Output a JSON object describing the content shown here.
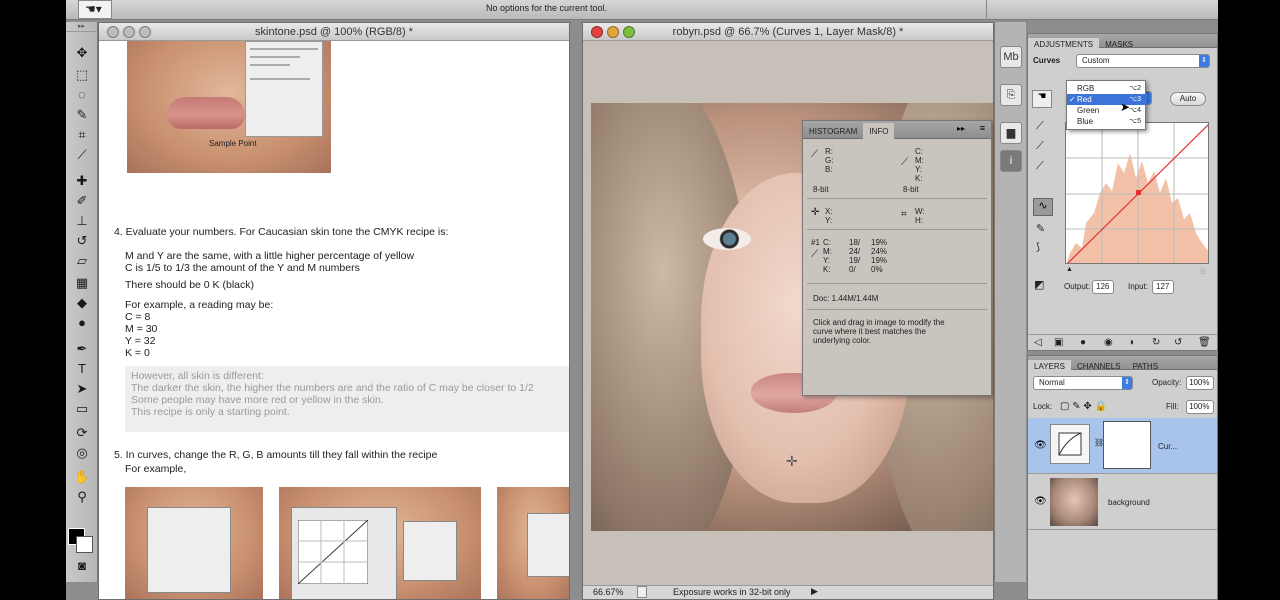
{
  "options_bar": {
    "message": "No options for the current tool."
  },
  "doc_left": {
    "title": "skintone.psd @ 100% (RGB/8) *",
    "sample_point_label": "Sample Point",
    "step4": {
      "heading": "4. Evaluate your numbers.  For Caucasian skin tone the CMYK recipe  is:",
      "lines": [
        "M and Y are the same, with a little higher percentage of yellow",
        "C is 1/5 to 1/3 the amount of the Y and M numbers",
        "There should be 0 K (black)"
      ],
      "example_intro": "For example, a reading may be:",
      "example": [
        "C = 8",
        "M = 30",
        "Y = 32",
        "K = 0"
      ]
    },
    "note": [
      "However, all skin is different:",
      "The darker the skin, the higher the numbers are and the ratio of C may be closer to 1/2",
      "Some people may have more red or yellow in the skin.",
      "This recipe is only a starting point."
    ],
    "step5": {
      "heading": "5. In curves, change the R, G, B amounts till they fall within the recipe",
      "example": "For example,"
    }
  },
  "doc_right": {
    "title": "robyn.psd @ 66.7% (Curves 1, Layer Mask/8) *",
    "zoom": "66.67%",
    "status": "Exposure works in 32-bit only"
  },
  "info_panel": {
    "tabs": [
      "HISTOGRAM",
      "INFO"
    ],
    "rgb_labels": [
      "R:",
      "G:",
      "B:"
    ],
    "cmyk_labels": [
      "C:",
      "M:",
      "Y:",
      "K:"
    ],
    "bit_left": "8-bit",
    "bit_right": "8-bit",
    "xy_labels": [
      "X:",
      "Y:"
    ],
    "wh_labels": [
      "W:",
      "H:"
    ],
    "sample": {
      "label": "#1",
      "rows": [
        {
          "ch": "C:",
          "a": "18/",
          "b": "19%"
        },
        {
          "ch": "M:",
          "a": "24/",
          "b": "24%"
        },
        {
          "ch": "Y:",
          "a": "19/",
          "b": "19%"
        },
        {
          "ch": "K:",
          "a": "0/",
          "b": "0%"
        }
      ]
    },
    "doc_size": "Doc: 1.44M/1.44M",
    "help": [
      "Click and drag in image to modify the",
      "curve where it best matches the",
      "underlying color."
    ]
  },
  "adjustments": {
    "tabs": [
      "ADJUSTMENTS",
      "MASKS"
    ],
    "type_label": "Curves",
    "preset": "Custom",
    "auto_label": "Auto",
    "channel_menu": [
      {
        "label": "RGB",
        "shortcut": "⌥2",
        "checked": false
      },
      {
        "label": "Red",
        "shortcut": "⌥3",
        "checked": true
      },
      {
        "label": "Green",
        "shortcut": "⌥4",
        "checked": false
      },
      {
        "label": "Blue",
        "shortcut": "⌥5",
        "checked": false
      }
    ],
    "output_label": "Output:",
    "output_value": "126",
    "input_label": "Input:",
    "input_value": "127"
  },
  "layers": {
    "tabs": [
      "LAYERS",
      "CHANNELS",
      "PATHS"
    ],
    "blend_mode": "Normal",
    "opacity_label": "Opacity:",
    "opacity_value": "100%",
    "lock_label": "Lock:",
    "fill_label": "Fill:",
    "fill_value": "100%",
    "items": [
      {
        "name": "Cur...",
        "selected": true
      },
      {
        "name": "background",
        "selected": false
      }
    ]
  },
  "colors": {
    "accent": "#3b73d9",
    "selected_layer": "#a8c4ec"
  }
}
